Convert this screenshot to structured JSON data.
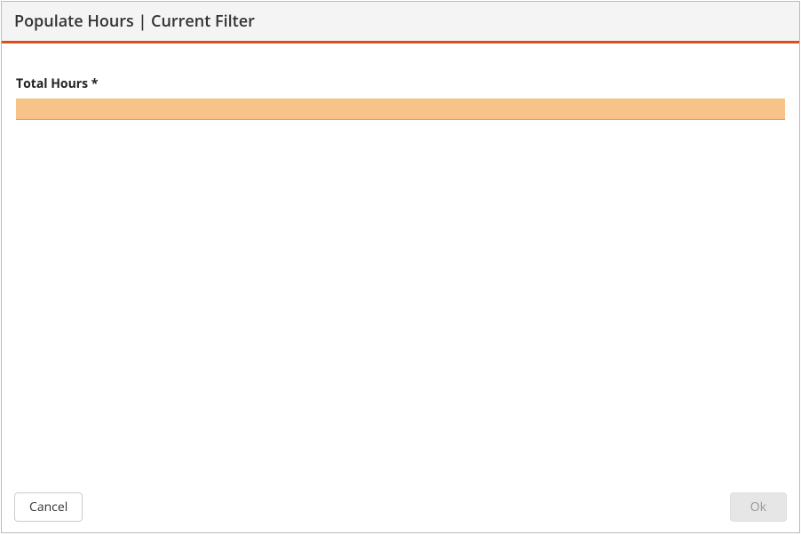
{
  "header": {
    "title": "Populate Hours | Current Filter"
  },
  "form": {
    "total_hours_label": "Total Hours *",
    "total_hours_value": ""
  },
  "footer": {
    "cancel_label": "Cancel",
    "ok_label": "Ok"
  }
}
